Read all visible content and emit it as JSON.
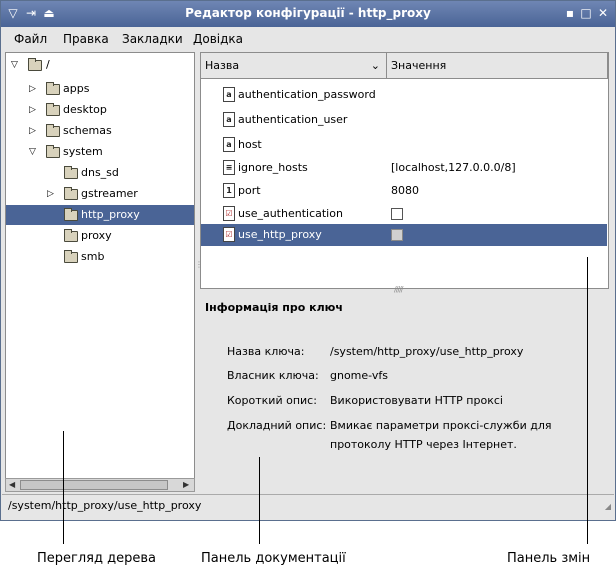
{
  "window": {
    "title": "Редактор конфігурації - http_proxy"
  },
  "menubar": [
    "Файл",
    "Правка",
    "Закладки",
    "Довідка"
  ],
  "tree": {
    "root_label": "/",
    "items": [
      {
        "label": "apps",
        "expander": "▷"
      },
      {
        "label": "desktop",
        "expander": "▷"
      },
      {
        "label": "schemas",
        "expander": "▷"
      },
      {
        "label": "system",
        "expander": "▽"
      },
      {
        "label": "dns_sd",
        "expander": ""
      },
      {
        "label": "gstreamer",
        "expander": "▷"
      },
      {
        "label": "http_proxy",
        "expander": "",
        "selected": true
      },
      {
        "label": "proxy",
        "expander": ""
      },
      {
        "label": "smb",
        "expander": ""
      }
    ]
  },
  "list": {
    "columns": {
      "name": "Назва",
      "value": "Значення"
    },
    "rows": [
      {
        "name": "authentication_password",
        "type": "string",
        "value": ""
      },
      {
        "name": "authentication_user",
        "type": "string",
        "value": ""
      },
      {
        "name": "host",
        "type": "string",
        "value": ""
      },
      {
        "name": "ignore_hosts",
        "type": "list",
        "value": "[localhost,127.0.0.0/8]"
      },
      {
        "name": "port",
        "type": "int",
        "value": "8080"
      },
      {
        "name": "use_authentication",
        "type": "bool",
        "value": "false"
      },
      {
        "name": "use_http_proxy",
        "type": "bool",
        "value": "false",
        "selected": true
      }
    ]
  },
  "info": {
    "heading": "Інформація про ключ",
    "key_name_label": "Назва ключа:",
    "key_name_value": "/system/http_proxy/use_http_proxy",
    "owner_label": "Власник ключа:",
    "owner_value": "gnome-vfs",
    "short_desc_label": "Короткий опис:",
    "short_desc_value": "Використовувати HTTP проксі",
    "long_desc_label": "Докладний опис:",
    "long_desc_value_line1": "Вмикає параметри проксі-служби для",
    "long_desc_value_line2": "протоколу HTTP через Інтернет."
  },
  "statusbar": {
    "path": "/system/http_proxy/use_http_proxy"
  },
  "callouts": {
    "tree": "Перегляд дерева",
    "docs": "Панель документації",
    "changes": "Панель змін"
  },
  "type_icons": {
    "string": "a",
    "list": "≡",
    "int": "1",
    "bool": "☑"
  },
  "colors": {
    "titlebar": "#4a6496",
    "selection": "#4a6496"
  }
}
